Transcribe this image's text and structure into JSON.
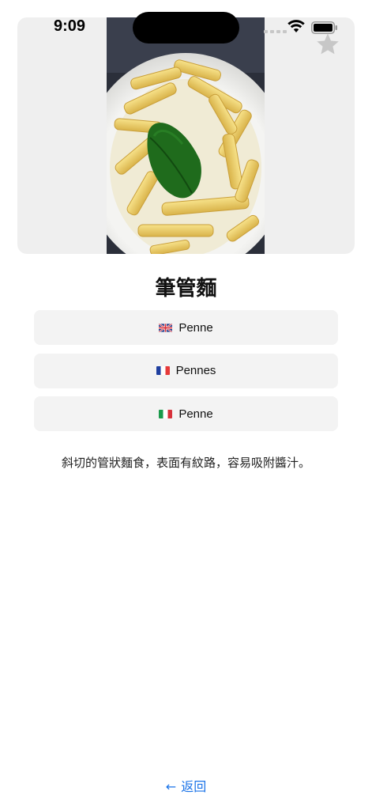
{
  "status_bar": {
    "time": "9:09"
  },
  "hero": {
    "image": "penne-pasta-with-basil-photo",
    "favorite_icon": "star-icon",
    "favorite_color": "#c7c7c7"
  },
  "dish": {
    "title": "筆管麵",
    "names": [
      {
        "flag": "uk-flag-icon",
        "label": "Penne"
      },
      {
        "flag": "france-flag-icon",
        "label": "Pennes"
      },
      {
        "flag": "italy-flag-icon",
        "label": "Penne"
      }
    ],
    "description": "斜切的管狀麵食，表面有紋路，容易吸附醬汁。"
  },
  "navigation": {
    "back_arrow": "←",
    "back_label": "返回",
    "link_color": "#1a73e8"
  }
}
